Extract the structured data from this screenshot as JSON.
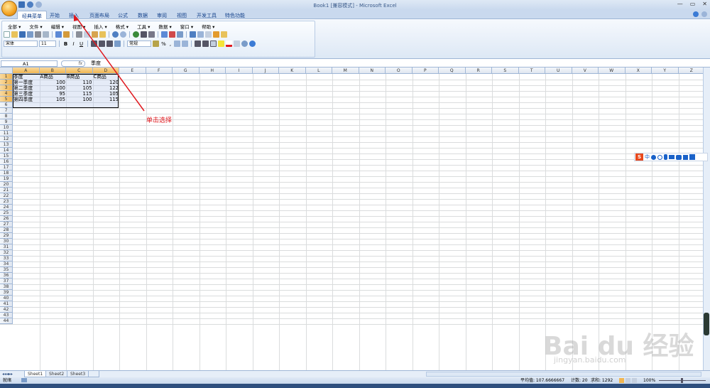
{
  "window": {
    "title": "Book1 [兼容模式] - Microsoft Excel",
    "controls": [
      "—",
      "▭",
      "✕"
    ]
  },
  "ribbon_tabs": [
    {
      "label": "经典菜单",
      "active": true
    },
    {
      "label": "开始",
      "active": false
    },
    {
      "label": "插入",
      "active": false
    },
    {
      "label": "页面布局",
      "active": false
    },
    {
      "label": "公式",
      "active": false
    },
    {
      "label": "数据",
      "active": false
    },
    {
      "label": "审阅",
      "active": false
    },
    {
      "label": "视图",
      "active": false
    },
    {
      "label": "开发工具",
      "active": false
    },
    {
      "label": "特色功能",
      "active": false
    }
  ],
  "classic_menu": [
    "全部 ▾",
    "文件 ▾",
    "编辑 ▾",
    "视图 ▾",
    "插入 ▾",
    "格式 ▾",
    "工具 ▾",
    "数据 ▾",
    "窗口 ▾",
    "帮助 ▾"
  ],
  "toolbar": {
    "font_name": "宋体",
    "font_size": "11",
    "bold": "B",
    "italic": "I",
    "underline": "U",
    "number_format": "常规",
    "percent": "%",
    "comma": ","
  },
  "formula_bar": {
    "name_box": "A1",
    "fx": "fx",
    "value": "季度"
  },
  "columns": [
    "A",
    "B",
    "C",
    "D",
    "E",
    "F",
    "G",
    "H",
    "I",
    "J",
    "K",
    "L",
    "M",
    "N",
    "O",
    "P",
    "Q",
    "R",
    "S",
    "T",
    "U",
    "V",
    "W",
    "X",
    "Y",
    "Z"
  ],
  "rows": [
    "1",
    "2",
    "3",
    "4",
    "5",
    "6",
    "7",
    "8",
    "9",
    "10",
    "11",
    "12",
    "13",
    "14",
    "15",
    "16",
    "17",
    "18",
    "19",
    "20",
    "21",
    "22",
    "23",
    "24",
    "25",
    "26",
    "27",
    "28",
    "29",
    "30",
    "31",
    "32",
    "33",
    "34",
    "35",
    "36",
    "37",
    "38",
    "39",
    "40",
    "41",
    "42",
    "43",
    "44"
  ],
  "table": {
    "header": [
      "季度",
      "A商品",
      "B商品",
      "C商品"
    ],
    "rows": [
      [
        "第一季度",
        "100",
        "110",
        "120"
      ],
      [
        "第二季度",
        "100",
        "105",
        "122"
      ],
      [
        "第三季度",
        "95",
        "115",
        "105"
      ],
      [
        "第四季度",
        "105",
        "100",
        "115"
      ]
    ]
  },
  "annotation": {
    "text": "单击选择",
    "color": "#e0191f"
  },
  "sheet_tabs": [
    {
      "label": "Sheet1",
      "active": true
    },
    {
      "label": "Sheet2",
      "active": false
    },
    {
      "label": "Sheet3",
      "active": false
    }
  ],
  "status": {
    "mode": "就绪",
    "average": "平均值: 107.6666667",
    "count": "计数: 20",
    "sum": "求和: 1292",
    "zoom": "100%"
  },
  "ime_toolbar": {
    "logo": "S",
    "lang": "中"
  },
  "watermark": {
    "logo": "Bai du 经验",
    "url": "jingyan.baidu.com"
  },
  "colors": {
    "accent": "#15428b",
    "selection_header": "#f1b652",
    "annotation": "#e0191f"
  }
}
